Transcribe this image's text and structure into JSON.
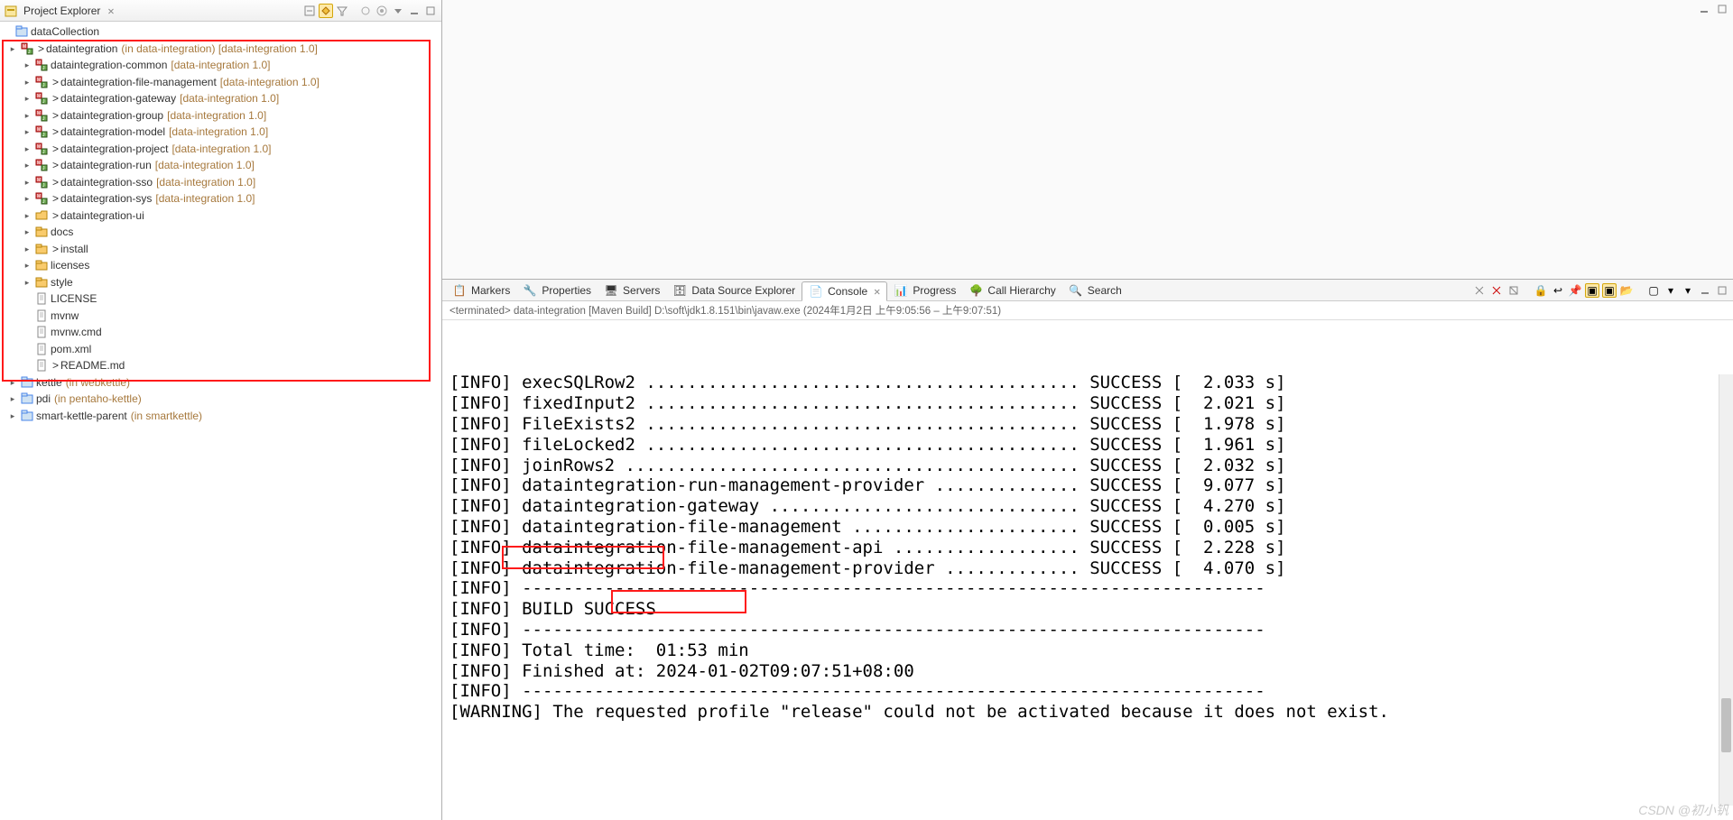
{
  "explorer": {
    "title": "Project Explorer",
    "root": "dataCollection",
    "nodes": [
      {
        "depth": 1,
        "exp": "▸",
        "icon": "maven",
        "gt": ">",
        "name": "dataintegration",
        "dec": "(in data-integration) [data-integration 1.0]"
      },
      {
        "depth": 2,
        "exp": "▸",
        "icon": "maven",
        "gt": "",
        "name": "dataintegration-common",
        "dec": "[data-integration 1.0]"
      },
      {
        "depth": 2,
        "exp": "▸",
        "icon": "maven",
        "gt": ">",
        "name": "dataintegration-file-management",
        "dec": "[data-integration 1.0]"
      },
      {
        "depth": 2,
        "exp": "▸",
        "icon": "maven",
        "gt": ">",
        "name": "dataintegration-gateway",
        "dec": "[data-integration 1.0]"
      },
      {
        "depth": 2,
        "exp": "▸",
        "icon": "maven",
        "gt": ">",
        "name": "dataintegration-group",
        "dec": "[data-integration 1.0]"
      },
      {
        "depth": 2,
        "exp": "▸",
        "icon": "maven",
        "gt": ">",
        "name": "dataintegration-model",
        "dec": "[data-integration 1.0]"
      },
      {
        "depth": 2,
        "exp": "▸",
        "icon": "maven",
        "gt": ">",
        "name": "dataintegration-project",
        "dec": "[data-integration 1.0]"
      },
      {
        "depth": 2,
        "exp": "▸",
        "icon": "maven",
        "gt": ">",
        "name": "dataintegration-run",
        "dec": "[data-integration 1.0]"
      },
      {
        "depth": 2,
        "exp": "▸",
        "icon": "maven",
        "gt": ">",
        "name": "dataintegration-sso",
        "dec": "[data-integration 1.0]"
      },
      {
        "depth": 2,
        "exp": "▸",
        "icon": "maven",
        "gt": ">",
        "name": "dataintegration-sys",
        "dec": "[data-integration 1.0]"
      },
      {
        "depth": 2,
        "exp": "▸",
        "icon": "folder-open",
        "gt": ">",
        "name": "dataintegration-ui",
        "dec": ""
      },
      {
        "depth": 2,
        "exp": "▸",
        "icon": "folder",
        "gt": "",
        "name": "docs",
        "dec": ""
      },
      {
        "depth": 2,
        "exp": "▸",
        "icon": "folder",
        "gt": ">",
        "name": "install",
        "dec": ""
      },
      {
        "depth": 2,
        "exp": "▸",
        "icon": "folder",
        "gt": "",
        "name": "licenses",
        "dec": ""
      },
      {
        "depth": 2,
        "exp": "▸",
        "icon": "folder",
        "gt": "",
        "name": "style",
        "dec": ""
      },
      {
        "depth": 2,
        "exp": "",
        "icon": "file",
        "gt": "",
        "name": "LICENSE",
        "dec": ""
      },
      {
        "depth": 2,
        "exp": "",
        "icon": "file",
        "gt": "",
        "name": "mvnw",
        "dec": ""
      },
      {
        "depth": 2,
        "exp": "",
        "icon": "file",
        "gt": "",
        "name": "mvnw.cmd",
        "dec": ""
      },
      {
        "depth": 2,
        "exp": "",
        "icon": "file",
        "gt": "",
        "name": "pom.xml",
        "dec": ""
      },
      {
        "depth": 2,
        "exp": "",
        "icon": "file",
        "gt": ">",
        "name": "README.md",
        "dec": ""
      },
      {
        "depth": 1,
        "exp": "▸",
        "icon": "project",
        "gt": "",
        "name": "kettle",
        "dec": "(in webkettle)"
      },
      {
        "depth": 1,
        "exp": "▸",
        "icon": "project",
        "gt": "",
        "name": "pdi",
        "dec": "(in pentaho-kettle)"
      },
      {
        "depth": 1,
        "exp": "▸",
        "icon": "project",
        "gt": "",
        "name": "smart-kettle-parent",
        "dec": "(in smartkettle)"
      }
    ]
  },
  "tabs": {
    "markers": "Markers",
    "properties": "Properties",
    "servers": "Servers",
    "dse": "Data Source Explorer",
    "console": "Console",
    "progress": "Progress",
    "callh": "Call Hierarchy",
    "search": "Search"
  },
  "terminated": "<terminated> data-integration [Maven Build] D:\\soft\\jdk1.8.151\\bin\\javaw.exe  (2024年1月2日 上午9:05:56 – 上午9:07:51)",
  "consoleLines": [
    "[INFO] execSQLRow2 .......................................... SUCCESS [  2.033 s]",
    "[INFO] fixedInput2 .......................................... SUCCESS [  2.021 s]",
    "[INFO] FileExists2 .......................................... SUCCESS [  1.978 s]",
    "[INFO] fileLocked2 .......................................... SUCCESS [  1.961 s]",
    "[INFO] joinRows2 ............................................ SUCCESS [  2.032 s]",
    "[INFO] dataintegration-run-management-provider .............. SUCCESS [  9.077 s]",
    "[INFO] dataintegration-gateway .............................. SUCCESS [  4.270 s]",
    "[INFO] dataintegration-file-management ...................... SUCCESS [  0.005 s]",
    "[INFO] dataintegration-file-management-api .................. SUCCESS [  2.228 s]",
    "[INFO] dataintegration-file-management-provider ............. SUCCESS [  4.070 s]",
    "[INFO] ------------------------------------------------------------------------",
    "[INFO] BUILD SUCCESS",
    "[INFO] ------------------------------------------------------------------------",
    "[INFO] Total time:  01:53 min",
    "[INFO] Finished at: 2024-01-02T09:07:51+08:00",
    "[INFO] ------------------------------------------------------------------------",
    "[WARNING] The requested profile \"release\" could not be activated because it does not exist."
  ],
  "watermark": "CSDN @初小钒"
}
